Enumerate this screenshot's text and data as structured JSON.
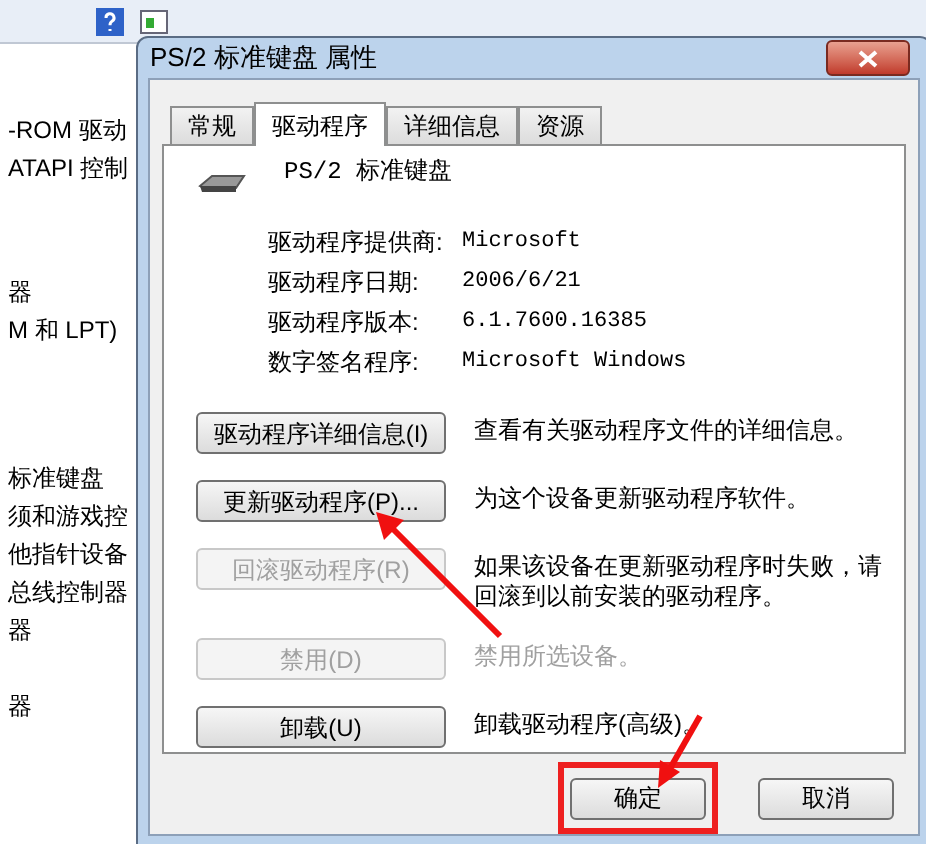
{
  "background_window": {
    "tree_items": [
      {
        "label": "-ROM 驱动"
      },
      {
        "label": "ATAPI 控制"
      },
      {
        "label": "器"
      },
      {
        "label": "M 和 LPT)"
      },
      {
        "label": "标准键盘"
      },
      {
        "label": "须和游戏控"
      },
      {
        "label": "他指针设备"
      },
      {
        "label": "总线控制器"
      },
      {
        "label": "器"
      },
      {
        "label": "器"
      }
    ]
  },
  "dialog": {
    "title": "PS/2 标准键盘 属性",
    "tabs": [
      {
        "label": "常规",
        "selected": false
      },
      {
        "label": "驱动程序",
        "selected": true
      },
      {
        "label": "详细信息",
        "selected": false
      },
      {
        "label": "资源",
        "selected": false
      }
    ],
    "device_name": "PS/2 标准键盘",
    "info": [
      {
        "label": "驱动程序提供商:",
        "value": "Microsoft"
      },
      {
        "label": "驱动程序日期:",
        "value": "2006/6/21"
      },
      {
        "label": "驱动程序版本:",
        "value": "6.1.7600.16385"
      },
      {
        "label": "数字签名程序:",
        "value": "Microsoft Windows"
      }
    ],
    "actions": [
      {
        "button": "驱动程序详细信息(I)",
        "description": "查看有关驱动程序文件的详细信息。",
        "disabled": false,
        "description_disabled": false
      },
      {
        "button": "更新驱动程序(P)...",
        "description": "为这个设备更新驱动程序软件。",
        "disabled": false,
        "description_disabled": false
      },
      {
        "button": "回滚驱动程序(R)",
        "description": "如果该设备在更新驱动程序时失败，请回滚到以前安装的驱动程序。",
        "disabled": true,
        "description_disabled": false
      },
      {
        "button": "禁用(D)",
        "description": "禁用所选设备。",
        "disabled": true,
        "description_disabled": true
      },
      {
        "button": "卸载(U)",
        "description": "卸载驱动程序(高级)。",
        "disabled": false,
        "description_disabled": false
      }
    ],
    "buttons": [
      {
        "label": "确定",
        "highlighted": true
      },
      {
        "label": "取消",
        "highlighted": false
      }
    ]
  }
}
